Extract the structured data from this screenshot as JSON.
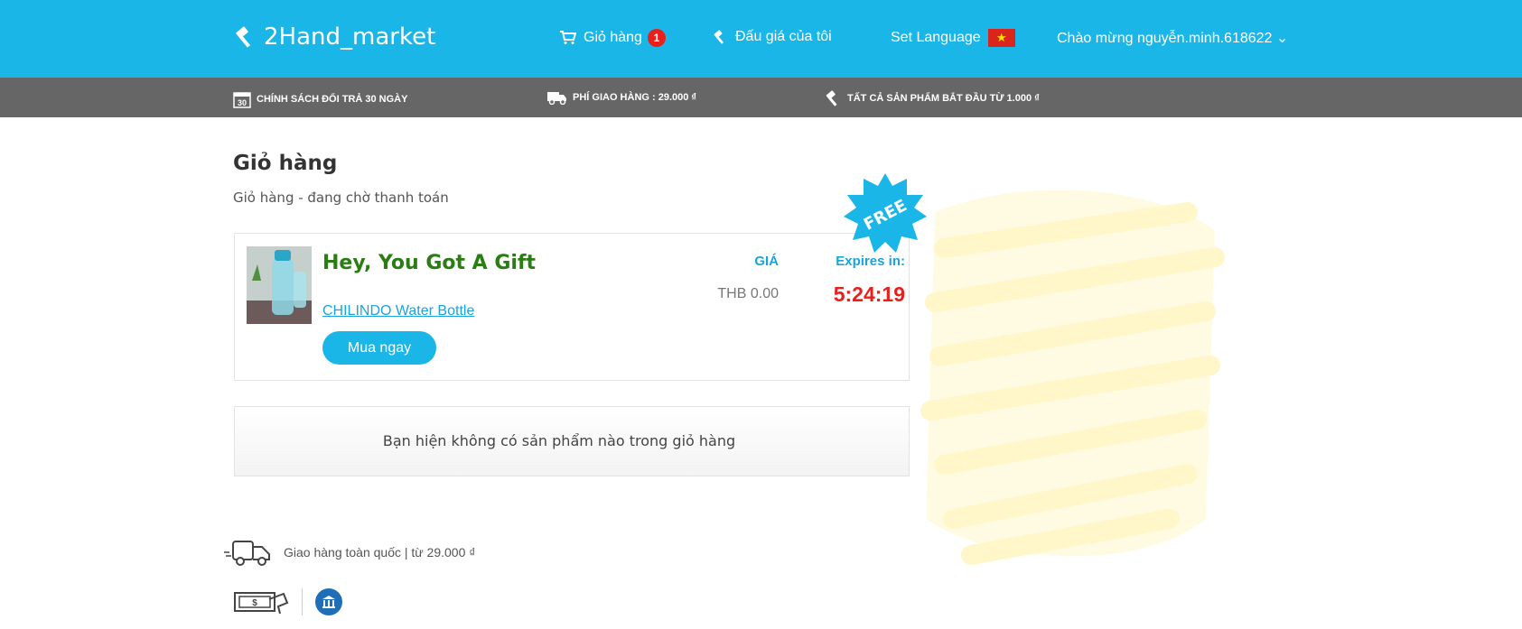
{
  "header": {
    "brand": "2Hand_market",
    "cart_label": "Giỏ hàng",
    "cart_count": "1",
    "my_auctions": "Đấu giá của tôi",
    "set_language": "Set Language",
    "language_flag": "vietnam-flag-icon",
    "greeting": "Chào mừng nguyễn.minh.618622 ⌄"
  },
  "promo_bar": {
    "return_policy_icon_text": "30",
    "return_policy": "CHÍNH SÁCH ĐỔI TRẢ 30 NGÀY",
    "shipping_fee": "PHÍ GIAO HÀNG : 29.000 ₫",
    "all_products": "TẤT CẢ SẢN PHẨM BẮT ĐẦU TỪ 1.000 ₫"
  },
  "cart": {
    "title": "Giỏ hàng",
    "subtitle": "Giỏ hàng - đang chờ thanh toán",
    "gift": {
      "title": "Hey, You Got A Gift",
      "product_link": "CHILINDO Water Bottle",
      "buy_button": "Mua ngay",
      "price_header": "GIÁ",
      "price": "THB 0.00",
      "expires_header": "Expires in:",
      "countdown": "5:24:19",
      "badge": "FREE"
    },
    "empty_message": "Bạn hiện không có sản phẩm nào trong giỏ hàng"
  },
  "footer_info": {
    "shipping_text": "Giao hàng toàn quốc | từ 29.000 ₫",
    "payment_icons": [
      "cash-payment-icon",
      "bank-icon"
    ]
  },
  "colors": {
    "header_blue": "#1bb6e8",
    "promo_gray": "#666666",
    "gift_green": "#2a7d12",
    "countdown_red": "#e8201c",
    "badge_red": "#e8201c"
  }
}
